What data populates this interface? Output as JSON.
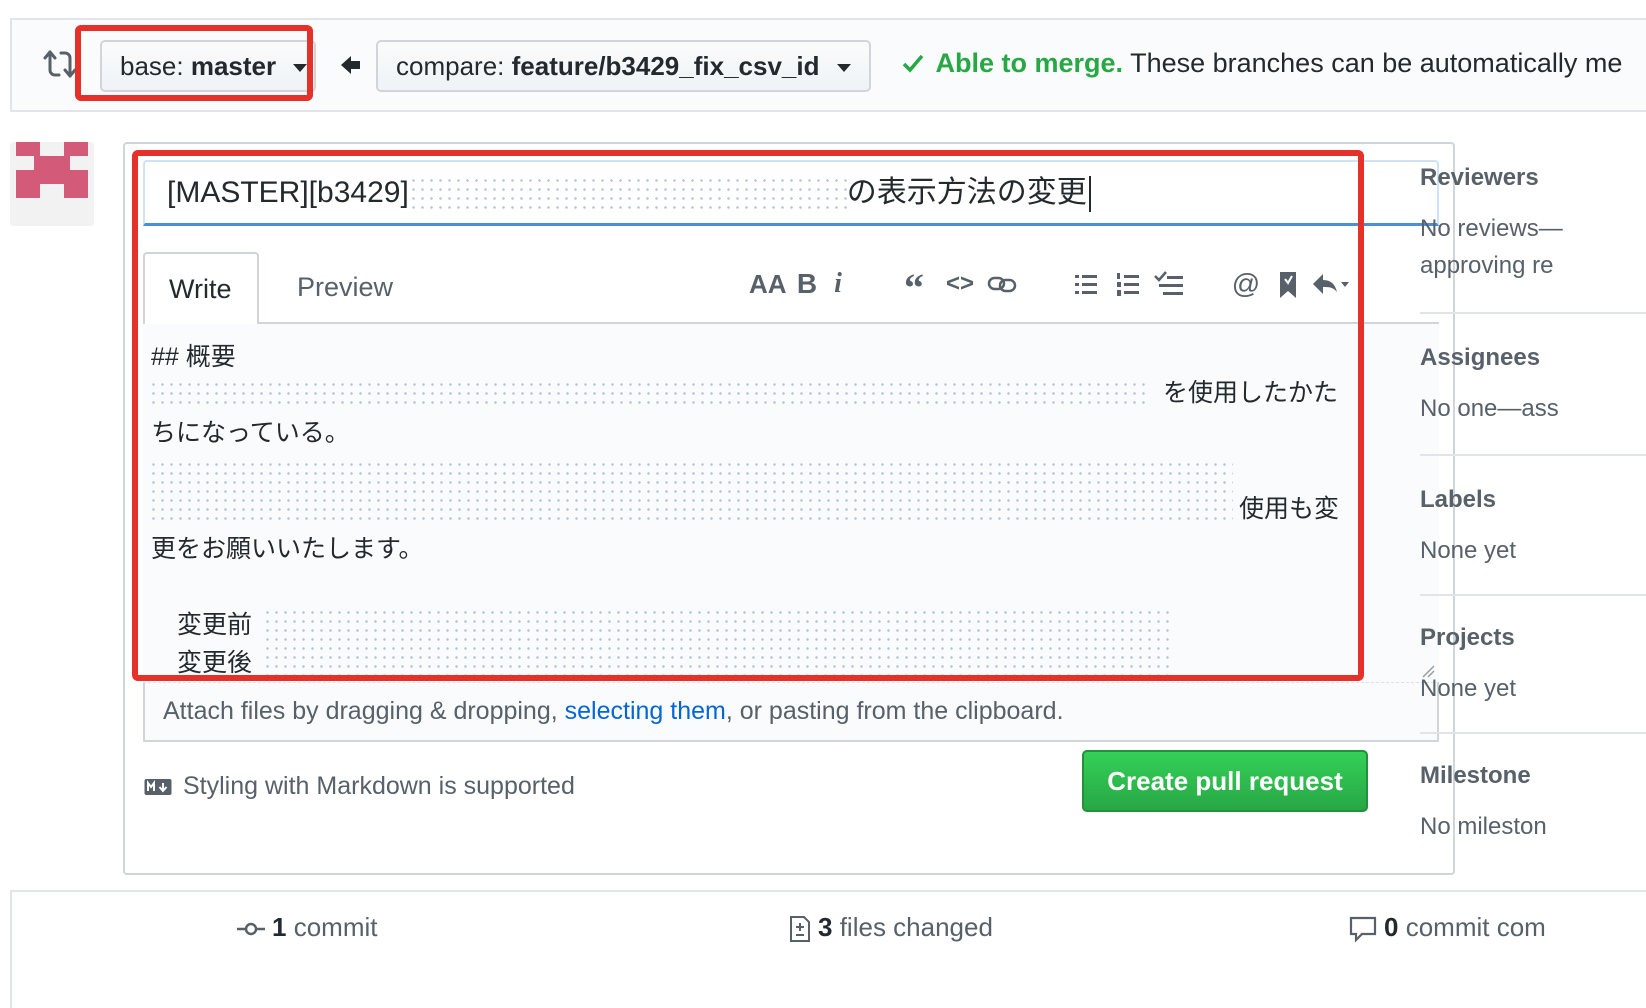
{
  "compare": {
    "base_prefix": "base:",
    "base_branch": "master",
    "compare_prefix": "compare:",
    "compare_branch": "feature/b3429_fix_csv_id",
    "merge_ok": "Able to merge.",
    "merge_text": "These branches can be automatically me"
  },
  "pr": {
    "title_prefix": "[MASTER][b3429]",
    "title_suffix": "の表示方法の変更"
  },
  "editor": {
    "tab_write": "Write",
    "tab_preview": "Preview",
    "toolbar_icons": [
      "text-size-icon",
      "bold-icon",
      "italic-icon",
      "quote-icon",
      "code-icon",
      "link-icon",
      "bulleted-list-icon",
      "numbered-list-icon",
      "task-list-icon",
      "mention-icon",
      "bookmark-icon",
      "reply-icon"
    ],
    "lines": {
      "heading": "## 概要",
      "l1_end": "を使用したかた",
      "l2": "ちになっている。",
      "l3_end": "使用も変",
      "l4": "更をお願いいたします。",
      "before": "変更前",
      "after": "変更後"
    },
    "attach_pre": "Attach files by dragging & dropping, ",
    "attach_link": "selecting them",
    "attach_post": ", or pasting from the clipboard.",
    "markdown_note": "Styling with Markdown is supported",
    "create_button": "Create pull request"
  },
  "sidebar": {
    "reviewers_heading": "Reviewers",
    "reviewers_text_1": "No reviews—",
    "reviewers_text_2": "approving re",
    "assignees_heading": "Assignees",
    "assignees_text": "No one—ass",
    "labels_heading": "Labels",
    "labels_text": "None yet",
    "projects_heading": "Projects",
    "projects_text": "None yet",
    "milestone_heading": "Milestone",
    "milestone_text": "No mileston"
  },
  "stats": {
    "commits_count": "1",
    "commits_label": "commit",
    "files_count": "3",
    "files_label": "files changed",
    "comments_count": "0",
    "comments_label": "commit com"
  },
  "colors": {
    "highlight_red": "#e5312a",
    "success_green": "#28a745",
    "link_blue": "#0366d6"
  }
}
